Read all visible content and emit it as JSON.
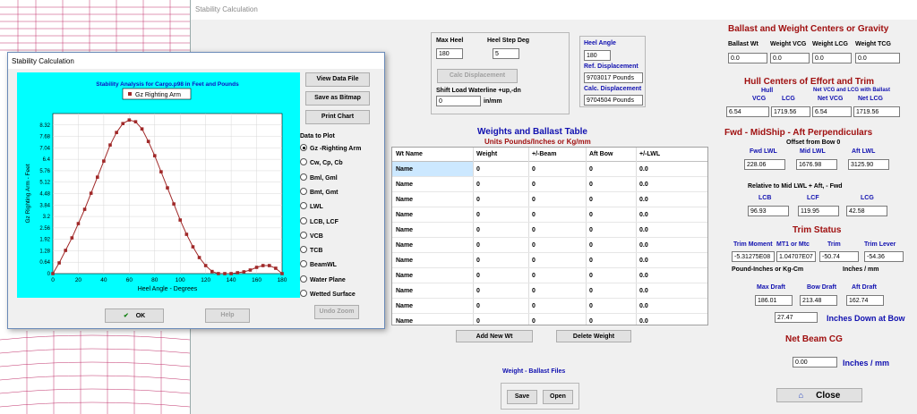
{
  "main_window": {
    "title": "Stability Calculation"
  },
  "heel": {
    "max_heel_label": "Max Heel",
    "max_heel_value": "180",
    "step_label": "Heel Step Deg",
    "step_value": "5",
    "calc_button": "Calc Displacement",
    "shift_label": "Shift Load Waterline +up,-dn",
    "shift_value": "0",
    "shift_unit": "in/mm",
    "angle_label": "Heel Angle",
    "angle_value": "180",
    "ref_disp_label": "Ref. Displacement",
    "ref_disp_value": "9703017 Pounds",
    "calc_disp_label": "Calc. Displacement",
    "calc_disp_value": "9704504 Pounds"
  },
  "weights_table": {
    "title": "Weights and Ballast Table",
    "subtitle": "Units Pounds/Inches or Kg/mm",
    "headers": [
      "Wt Name",
      "Weight",
      "+/-Beam",
      "Aft Bow",
      "+/-LWL"
    ],
    "rows": [
      [
        "Name",
        "0",
        "0",
        "0",
        "0.0"
      ],
      [
        "Name",
        "0",
        "0",
        "0",
        "0.0"
      ],
      [
        "Name",
        "0",
        "0",
        "0",
        "0.0"
      ],
      [
        "Name",
        "0",
        "0",
        "0",
        "0.0"
      ],
      [
        "Name",
        "0",
        "0",
        "0",
        "0.0"
      ],
      [
        "Name",
        "0",
        "0",
        "0",
        "0.0"
      ],
      [
        "Name",
        "0",
        "0",
        "0",
        "0.0"
      ],
      [
        "Name",
        "0",
        "0",
        "0",
        "0.0"
      ],
      [
        "Name",
        "0",
        "0",
        "0",
        "0.0"
      ],
      [
        "Name",
        "0",
        "0",
        "0",
        "0.0"
      ],
      [
        "Name",
        "0",
        "0",
        "0",
        "0.0"
      ]
    ],
    "add_button": "Add New Wt",
    "delete_button": "Delete Weight"
  },
  "ballast_files": {
    "label": "Weight - Ballast Files",
    "save": "Save",
    "open": "Open"
  },
  "ballast_cg": {
    "title": "Ballast and Weight Centers or Gravity",
    "labels": [
      "Ballast Wt",
      "Weight VCG",
      "Weight LCG",
      "Weight TCG"
    ],
    "values": [
      "0.0",
      "0.0",
      "0.0",
      "0.0"
    ]
  },
  "hull_centers": {
    "title": "Hull Centers of Effort and Trim",
    "hull_label": "Hull",
    "vcg_label": "VCG",
    "lcg_label": "LCG",
    "net_label": "Net VCG and LCG with Ballast",
    "net_vcg_label": "Net VCG",
    "net_lcg_label": "Net LCG",
    "values": [
      "6.54",
      "1719.56",
      "6.54",
      "1719.56"
    ]
  },
  "perpendiculars": {
    "title": "Fwd -  MidShip -  Aft Perpendiculars",
    "offset_label": "Offset from Bow 0",
    "fwd_label": "Fwd  LWL",
    "mid_label": "Mid LWL",
    "aft_label": "Aft LWL",
    "fwd_value": "228.06",
    "mid_value": "1676.98",
    "aft_value": "3125.90",
    "relative_label": "Relative to Mid LWL + Aft, - Fwd",
    "lcb_label": "LCB",
    "lcf_label": "LCF",
    "lcg_label": "LCG",
    "lcb_value": "96.93",
    "lcf_value": "119.95",
    "lcg_value": "42.58"
  },
  "trim": {
    "title": "Trim Status",
    "moment_label": "Trim Moment",
    "mt1_label": "MT1 or Mtc",
    "trim_label": "Trim",
    "lever_label": "Trim Lever",
    "moment_value": "-5.31275E08",
    "mt1_value": "1.04707E07",
    "trim_value": "-50.74",
    "lever_value": "-54.36",
    "units_label": "Pound-Inches or Kg-Cm",
    "inches_label": "Inches / mm",
    "max_draft_label": "Max Draft",
    "bow_draft_label": "Bow Draft",
    "aft_draft_label": "Aft Draft",
    "max_draft_value": "186.01",
    "bow_draft_value": "213.48",
    "aft_draft_value": "162.74",
    "down_value": "27.47",
    "down_label": "Inches Down at Bow"
  },
  "beam_cg": {
    "title": "Net Beam CG",
    "value": "0.00",
    "unit": "Inches / mm"
  },
  "close_button": "Close",
  "stability_dialog": {
    "title": "Stability Calculation",
    "buttons": {
      "view": "View Data File",
      "save": "Save as Bitmap",
      "print": "Print Chart",
      "ok": "OK",
      "help": "Help",
      "undo": "Undo Zoom"
    },
    "data_to_plot_label": "Data to Plot",
    "options": [
      "Gz -Righting Arm",
      "Cw, Cp, Cb",
      "Bml, Gml",
      "Bmt, Gmt",
      "LWL",
      "LCB, LCF",
      "VCB",
      "TCB",
      "BeamWL",
      "Water Plane",
      "Wetted Surface"
    ],
    "selected_option": 0
  },
  "chart_data": {
    "type": "line",
    "title": "Stability Analysis for Cargo.p98 in Feet and Pounds",
    "xlabel": "Heel Angle - Degrees",
    "ylabel": "Gz Righting Arm - Feet",
    "legend": "top-center",
    "series": [
      {
        "name": "Gz Righting Arm",
        "color": "#a02828"
      }
    ],
    "x": [
      0,
      5,
      10,
      15,
      20,
      25,
      30,
      35,
      40,
      45,
      50,
      55,
      60,
      65,
      70,
      75,
      80,
      85,
      90,
      95,
      100,
      105,
      110,
      115,
      120,
      125,
      130,
      135,
      140,
      145,
      150,
      155,
      160,
      165,
      170,
      175,
      180
    ],
    "values": [
      0,
      0.6,
      1.3,
      2.0,
      2.8,
      3.6,
      4.5,
      5.4,
      6.3,
      7.2,
      7.9,
      8.4,
      8.6,
      8.5,
      8.1,
      7.4,
      6.6,
      5.7,
      4.8,
      3.9,
      3.0,
      2.2,
      1.5,
      0.9,
      0.45,
      0.12,
      0.0,
      0.0,
      0.0,
      0.05,
      0.1,
      0.2,
      0.35,
      0.45,
      0.45,
      0.3,
      0.0
    ],
    "xticks": [
      0,
      20,
      40,
      60,
      80,
      100,
      120,
      140,
      160,
      180
    ],
    "yticks": [
      "0",
      "0.64",
      "1.28",
      "1.92",
      "2.56",
      "3.2",
      "3.84",
      "4.48",
      "5.12",
      "5.76",
      "6.4",
      "7.04",
      "7.68",
      "8.32"
    ],
    "xlim": [
      0,
      180
    ],
    "ylim": [
      0,
      8.96
    ],
    "grid": true
  }
}
